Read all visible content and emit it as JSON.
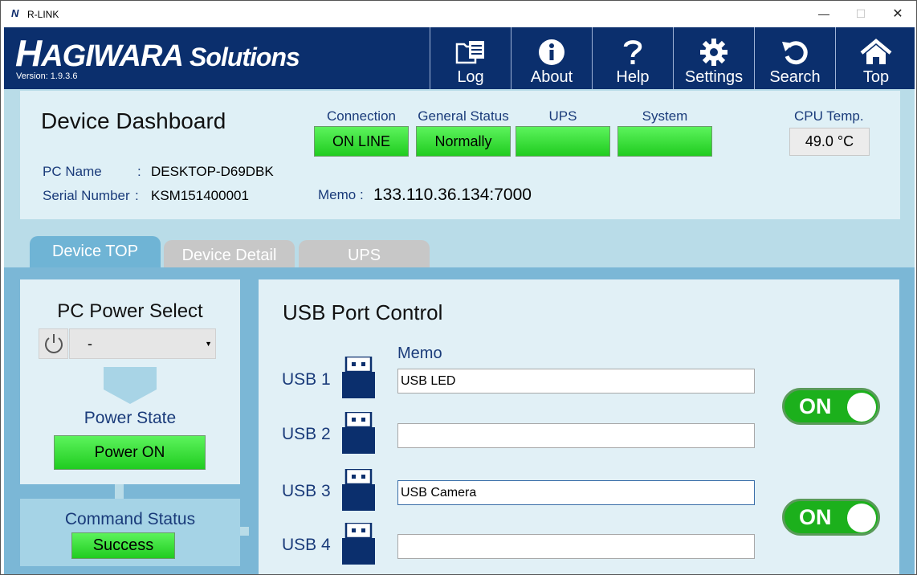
{
  "window": {
    "title": "R-LINK",
    "icon_letter": "N",
    "controls": {
      "minimize": "—",
      "maximize": "☐",
      "close": "✕"
    }
  },
  "header": {
    "logo": "HAGIWARA Solutions",
    "version": "Version:  1.9.3.6",
    "nav": [
      {
        "label": "Log",
        "icon": "log-icon"
      },
      {
        "label": "About",
        "icon": "info-icon"
      },
      {
        "label": "Help",
        "icon": "question-icon"
      },
      {
        "label": "Settings",
        "icon": "gear-icon"
      },
      {
        "label": "Search",
        "icon": "refresh-icon"
      },
      {
        "label": "Top",
        "icon": "home-icon"
      }
    ]
  },
  "dashboard": {
    "title": "Device Dashboard",
    "status": [
      {
        "header": "Connection",
        "value": "ON LINE"
      },
      {
        "header": "General Status",
        "value": "Normally"
      },
      {
        "header": "UPS",
        "value": ""
      },
      {
        "header": "System",
        "value": ""
      }
    ],
    "cpu_temp": {
      "header": "CPU Temp.",
      "value": "49.0 °C"
    },
    "pc_name": {
      "label": "PC Name",
      "sep": ":",
      "value": "DESKTOP-D69DBK"
    },
    "serial": {
      "label": "Serial Number",
      "sep": ":",
      "value": "KSM151400001"
    },
    "memo": {
      "label": "Memo :",
      "value": "133.110.36.134:7000"
    }
  },
  "tabs": [
    "Device TOP",
    "Device Detail",
    "UPS"
  ],
  "power": {
    "title": "PC Power Select",
    "select_value": "-",
    "state_label": "Power State",
    "state_value": "Power ON"
  },
  "command": {
    "label": "Command Status",
    "value": "Success"
  },
  "usb": {
    "title": "USB Port Control",
    "memo_header": "Memo",
    "ports": [
      {
        "label": "USB 1",
        "memo": "USB LED"
      },
      {
        "label": "USB 2",
        "memo": ""
      },
      {
        "label": "USB 3",
        "memo": "USB Camera"
      },
      {
        "label": "USB 4",
        "memo": ""
      }
    ],
    "toggles": [
      "ON",
      "ON"
    ]
  },
  "colors": {
    "header_bg": "#0b2f6d",
    "status_green": "#20cc20",
    "panel_bg": "#e1f0f6",
    "accent_text": "#1a3b7a"
  }
}
